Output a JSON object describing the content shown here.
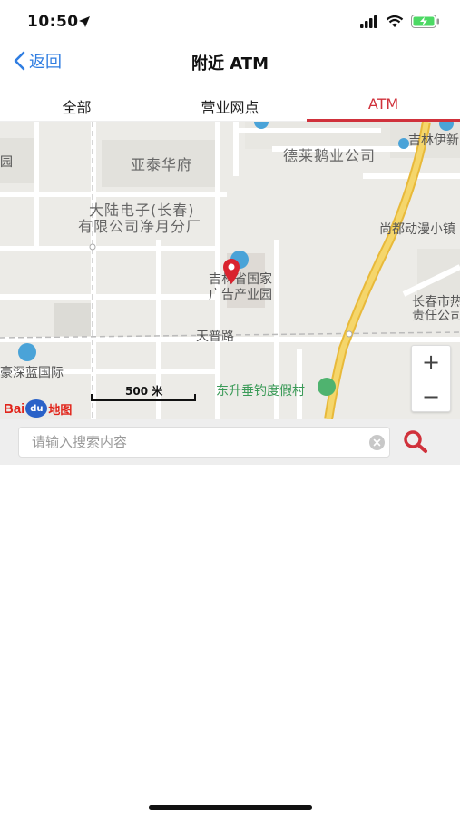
{
  "status": {
    "time": "10:50"
  },
  "nav": {
    "back_label": "返回",
    "title": "附近 ATM"
  },
  "tabs": [
    {
      "label": "全部",
      "active": false
    },
    {
      "label": "营业网点",
      "active": false
    },
    {
      "label": "ATM",
      "active": true
    }
  ],
  "map": {
    "labels": {
      "yatai": "亚泰华府",
      "delai": "德莱鹅业公司",
      "jilinyixin": "吉林伊新",
      "dalu_1": "大陆电子(长春)",
      "dalu_2": "有限公司净月分厂",
      "shangdu": "尚都动漫小镇",
      "park_1": "吉林省国家",
      "park_2": "广告产业园",
      "changchun_1": "长春市热",
      "changchun_2": "责任公司",
      "tianpu": "天普路",
      "haoshen": "豪深蓝国际",
      "dongsheng": "东升垂钓度假村",
      "edge_left": "园"
    },
    "scale_label": "500 米",
    "logo_text": {
      "bai": "Bai",
      "du": "du",
      "map": "地图"
    },
    "zoom_in": "+",
    "zoom_out": "−"
  },
  "search": {
    "placeholder": "请输入搜索内容",
    "value": ""
  },
  "colors": {
    "accent_red": "#d0313b",
    "ios_blue": "#2f7de1",
    "road_yellow": "#f5c842",
    "battery_green": "#4cd964"
  }
}
